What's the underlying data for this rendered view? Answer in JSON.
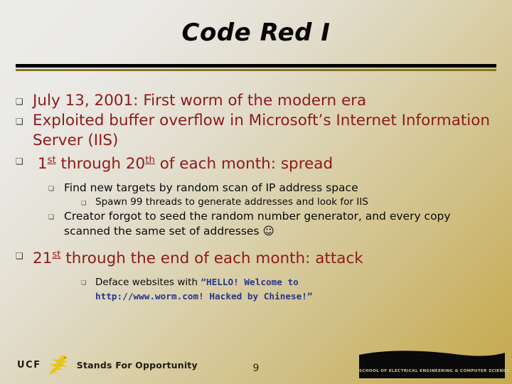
{
  "slide": {
    "title": "Code Red I",
    "page_number": "9",
    "colors": {
      "heading_red": "#8d1a1a",
      "body_black": "#0a0a0a",
      "mono_blue": "#28358c",
      "rule_black": "#000000",
      "rule_gold": "#8a7320",
      "background_start": "#ececeb",
      "background_end": "#c6a94e"
    }
  },
  "bullets": {
    "b1": "July 13, 2001: First worm of the modern era",
    "b2": "Exploited buffer overflow in Microsoft’s Internet Information Server (IIS)",
    "b3_pre": "1",
    "b3_sup1": "st",
    "b3_mid": " through 20",
    "b3_sup2": "th",
    "b3_post": " of each month: spread",
    "b3_1": "Find new targets by random scan of IP address space",
    "b3_1_1": "Spawn 99 threads to generate addresses and look for IIS",
    "b3_2_a": "Creator forgot to seed the random number generator, and every copy scanned the same set of addresses ",
    "b3_2_smiley": "☺",
    "b4_pre": "21",
    "b4_sup": "st",
    "b4_post": " through the end of each month: attack",
    "b4_1_pre": "Deface websites with ",
    "b4_1_quote_open": "“",
    "b4_1_mono_line1": "HELLO! Welcome to",
    "b4_1_mono_line2": "http://www.worm.com! Hacked by Chinese!",
    "b4_1_quote_close": "”"
  },
  "markers": {
    "level1": "❑",
    "level2": "❑",
    "level3": "❑"
  },
  "footer": {
    "ucf_word": "UCF",
    "tagline": "Stands For Opportunity",
    "eecs_banner_text": "SCHOOL OF ELECTRICAL ENGINEERING & COMPUTER SCIENCE",
    "pegasus_icon": "pegasus-logo-icon"
  }
}
